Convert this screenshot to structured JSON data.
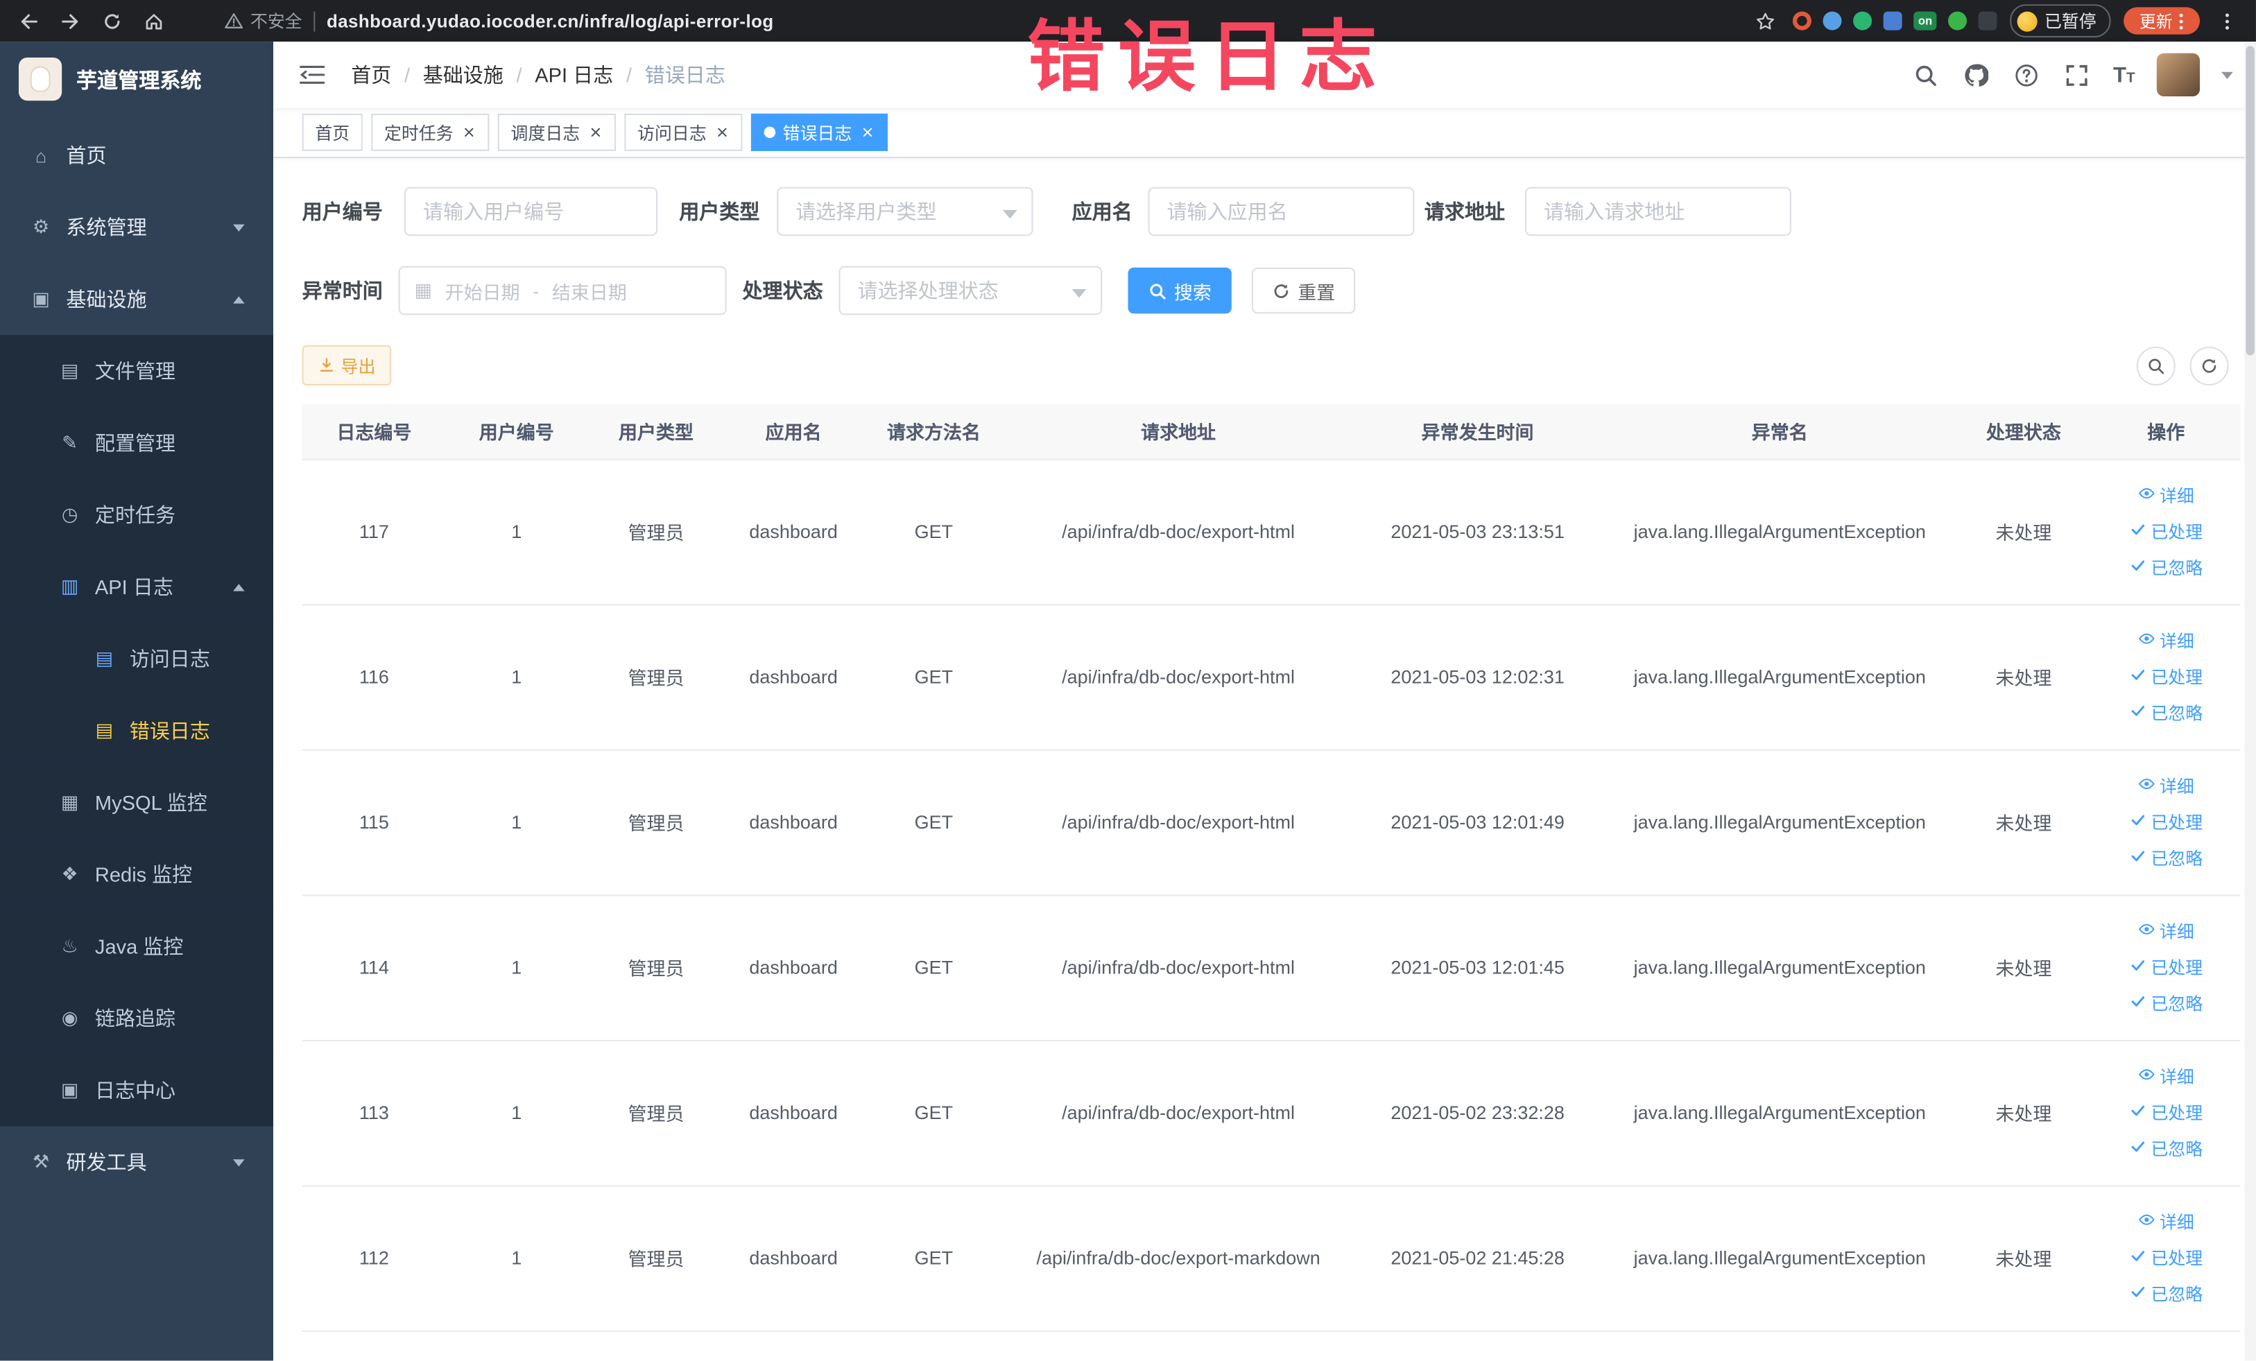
{
  "colors": {
    "accent": "#409eff",
    "menu_active": "#ffd04b",
    "sidebar_bg": "#304156",
    "submenu_bg": "#1f2d3d",
    "annotation": "#f4475f",
    "update_button": "#e2593b"
  },
  "annotation": "错误日志",
  "browser": {
    "security_label": "不安全",
    "url": "dashboard.yudao.iocoder.cn/infra/log/api-error-log",
    "paused_badge": "已暂停",
    "update_button": "更新",
    "extensions": [
      {
        "color": "#e2593b",
        "shape": "ring"
      },
      {
        "color": "#57a0e5",
        "shape": "circle"
      },
      {
        "color": "#2bb673",
        "shape": "circle"
      },
      {
        "color": "#4a7fd4",
        "shape": "grid"
      },
      {
        "color": "#1f8a4c",
        "shape": "badge",
        "text": "on"
      },
      {
        "color": "#3bb54a",
        "shape": "circle"
      },
      {
        "color": "#3a3f45",
        "shape": "pin"
      }
    ]
  },
  "sidebar": {
    "logo_title": "芋道管理系统",
    "menu": [
      {
        "key": "home",
        "label": "首页",
        "glyph": "⌂",
        "level": 1
      },
      {
        "key": "system",
        "label": "系统管理",
        "glyph": "⚙",
        "level": 1,
        "arrow": "down"
      },
      {
        "key": "infra",
        "label": "基础设施",
        "glyph": "▣",
        "level": 1,
        "arrow": "up"
      },
      {
        "key": "file",
        "label": "文件管理",
        "glyph": "▤",
        "level": 2,
        "sub": true
      },
      {
        "key": "config",
        "label": "配置管理",
        "glyph": "✎",
        "level": 2,
        "sub": true
      },
      {
        "key": "job",
        "label": "定时任务",
        "glyph": "◷",
        "level": 2,
        "sub": true
      },
      {
        "key": "api-log",
        "label": "API 日志",
        "glyph": "▥",
        "level": 2,
        "sub": true,
        "arrow": "up",
        "blue": true
      },
      {
        "key": "access-log",
        "label": "访问日志",
        "glyph": "▤",
        "level": 3,
        "sub": true,
        "blue": true
      },
      {
        "key": "error-log",
        "label": "错误日志",
        "glyph": "▤",
        "level": 3,
        "sub": true,
        "blue": true,
        "active": true
      },
      {
        "key": "mysql",
        "label": "MySQL 监控",
        "glyph": "▦",
        "level": 2,
        "sub": true
      },
      {
        "key": "redis",
        "label": "Redis 监控",
        "glyph": "❖",
        "level": 2,
        "sub": true
      },
      {
        "key": "java",
        "label": "Java 监控",
        "glyph": "♨",
        "level": 2,
        "sub": true
      },
      {
        "key": "trace",
        "label": "链路追踪",
        "glyph": "◉",
        "level": 2,
        "sub": true
      },
      {
        "key": "log-center",
        "label": "日志中心",
        "glyph": "▣",
        "level": 2,
        "sub": true
      },
      {
        "key": "dev-tools",
        "label": "研发工具",
        "glyph": "⚒",
        "level": 1,
        "arrow": "down"
      }
    ]
  },
  "breadcrumb": [
    "首页",
    "基础设施",
    "API 日志",
    "错误日志"
  ],
  "breadcrumb_separator": "/",
  "tabs": [
    {
      "label": "首页",
      "closable": false,
      "active": false
    },
    {
      "label": "定时任务",
      "closable": true,
      "active": false
    },
    {
      "label": "调度日志",
      "closable": true,
      "active": false
    },
    {
      "label": "访问日志",
      "closable": true,
      "active": false
    },
    {
      "label": "错误日志",
      "closable": true,
      "active": true
    }
  ],
  "filters": {
    "user_id": {
      "label": "用户编号",
      "placeholder": "请输入用户编号"
    },
    "user_type": {
      "label": "用户类型",
      "placeholder": "请选择用户类型"
    },
    "app_name": {
      "label": "应用名",
      "placeholder": "请输入应用名"
    },
    "request_url": {
      "label": "请求地址",
      "placeholder": "请输入请求地址"
    },
    "exception_time": {
      "label": "异常时间",
      "start_placeholder": "开始日期",
      "separator": "-",
      "end_placeholder": "结束日期"
    },
    "process_status": {
      "label": "处理状态",
      "placeholder": "请选择处理状态"
    },
    "search_button": "搜索",
    "reset_button": "重置"
  },
  "toolbar": {
    "export_button": "导出"
  },
  "table": {
    "columns": [
      "日志编号",
      "用户编号",
      "用户类型",
      "应用名",
      "请求方法名",
      "请求地址",
      "异常发生时间",
      "异常名",
      "处理状态",
      "操作"
    ],
    "row_actions": [
      "详细",
      "已处理",
      "已忽略"
    ],
    "rows": [
      {
        "id": "117",
        "user_id": "1",
        "user_type": "管理员",
        "app": "dashboard",
        "method": "GET",
        "url": "/api/infra/db-doc/export-html",
        "time": "2021-05-03 23:13:51",
        "exception": "java.lang.IllegalArgumentException",
        "status": "未处理"
      },
      {
        "id": "116",
        "user_id": "1",
        "user_type": "管理员",
        "app": "dashboard",
        "method": "GET",
        "url": "/api/infra/db-doc/export-html",
        "time": "2021-05-03 12:02:31",
        "exception": "java.lang.IllegalArgumentException",
        "status": "未处理"
      },
      {
        "id": "115",
        "user_id": "1",
        "user_type": "管理员",
        "app": "dashboard",
        "method": "GET",
        "url": "/api/infra/db-doc/export-html",
        "time": "2021-05-03 12:01:49",
        "exception": "java.lang.IllegalArgumentException",
        "status": "未处理"
      },
      {
        "id": "114",
        "user_id": "1",
        "user_type": "管理员",
        "app": "dashboard",
        "method": "GET",
        "url": "/api/infra/db-doc/export-html",
        "time": "2021-05-03 12:01:45",
        "exception": "java.lang.IllegalArgumentException",
        "status": "未处理"
      },
      {
        "id": "113",
        "user_id": "1",
        "user_type": "管理员",
        "app": "dashboard",
        "method": "GET",
        "url": "/api/infra/db-doc/export-html",
        "time": "2021-05-02 23:32:28",
        "exception": "java.lang.IllegalArgumentException",
        "status": "未处理"
      },
      {
        "id": "112",
        "user_id": "1",
        "user_type": "管理员",
        "app": "dashboard",
        "method": "GET",
        "url": "/api/infra/db-doc/export-markdown",
        "time": "2021-05-02 21:45:28",
        "exception": "java.lang.IllegalArgumentException",
        "status": "未处理"
      }
    ]
  }
}
